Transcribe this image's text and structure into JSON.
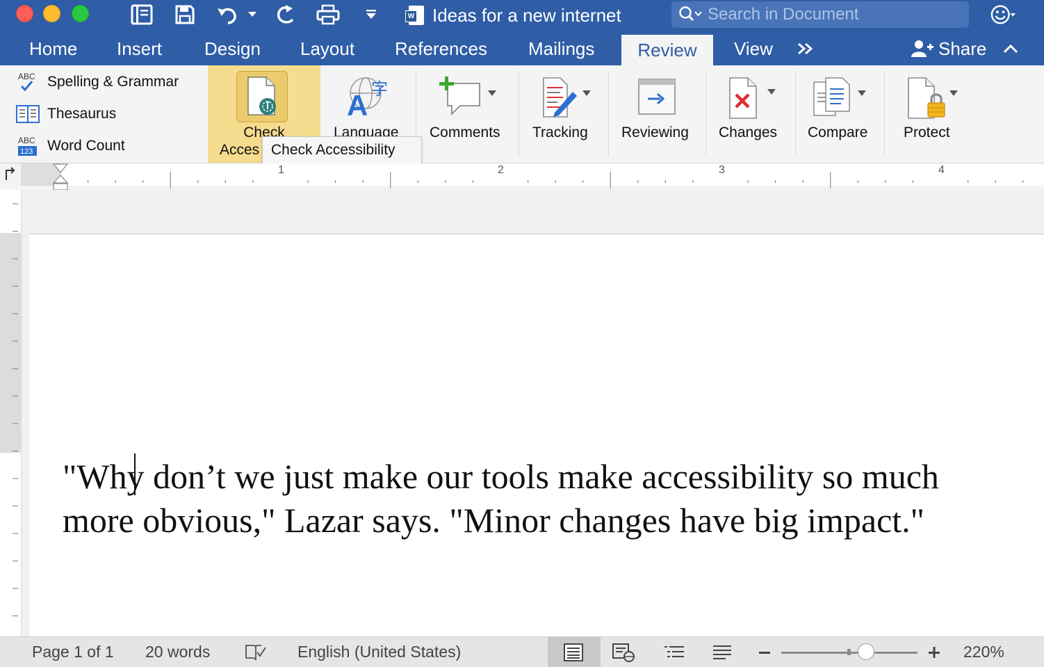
{
  "window": {
    "title": "Ideas for a new internet",
    "search_placeholder": "Search in Document"
  },
  "tabs": [
    {
      "label": "Home"
    },
    {
      "label": "Insert"
    },
    {
      "label": "Design"
    },
    {
      "label": "Layout"
    },
    {
      "label": "References"
    },
    {
      "label": "Mailings"
    },
    {
      "label": "Review",
      "active": true
    },
    {
      "label": "View"
    }
  ],
  "share_label": "Share",
  "ribbon": {
    "proofing": [
      {
        "label": "Spelling & Grammar",
        "icon": "spelling-check-icon"
      },
      {
        "label": "Thesaurus",
        "icon": "thesaurus-book-icon"
      },
      {
        "label": "Word Count",
        "icon": "word-count-icon"
      }
    ],
    "check_accessibility": {
      "line1": "Check",
      "line2": "Acces"
    },
    "language": "Language",
    "comments": "Comments",
    "tracking": "Tracking",
    "reviewing": "Reviewing",
    "changes": "Changes",
    "compare": "Compare",
    "protect": "Protect",
    "tooltip": "Check Accessibility"
  },
  "ruler": {
    "labels": [
      "1",
      "2",
      "3",
      "4"
    ]
  },
  "document": {
    "text": "\"Why don’t we just make our tools make accessibility so much more obvious,\" Lazar says. \"Minor changes have big impact.\""
  },
  "status": {
    "page": "Page 1 of 1",
    "words": "20 words",
    "language": "English (United States)",
    "zoom": "220%",
    "zoom_level_percent": 220
  },
  "colors": {
    "titlebar": "#2f5da6",
    "ribbon": "#f4f4f4",
    "highlight": "#f6dc8e"
  }
}
